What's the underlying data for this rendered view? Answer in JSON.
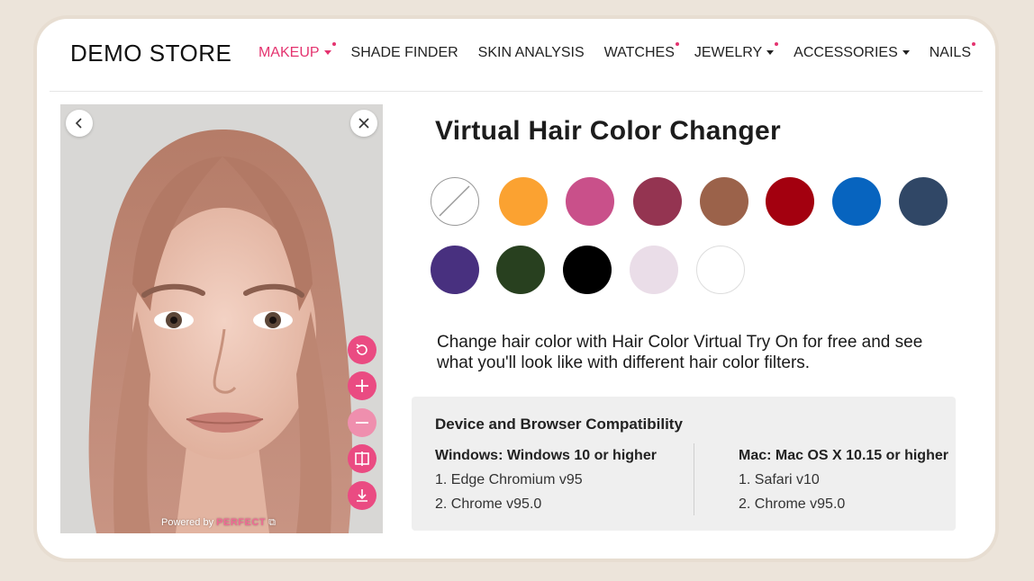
{
  "store": {
    "logo": "DEMO STORE"
  },
  "nav": [
    {
      "label": "MAKEUP",
      "active": true,
      "dropdown": true,
      "dot": true
    },
    {
      "label": "SHADE FINDER",
      "active": false,
      "dropdown": false,
      "dot": false
    },
    {
      "label": "SKIN ANALYSIS",
      "active": false,
      "dropdown": false,
      "dot": false
    },
    {
      "label": "WATCHES",
      "active": false,
      "dropdown": false,
      "dot": true
    },
    {
      "label": "JEWELRY",
      "active": false,
      "dropdown": true,
      "dot": true
    },
    {
      "label": "ACCESSORIES",
      "active": false,
      "dropdown": true,
      "dot": false
    },
    {
      "label": "NAILS",
      "active": false,
      "dropdown": false,
      "dot": true
    }
  ],
  "viewer": {
    "back_icon": "chevron-left-icon",
    "close_icon": "close-icon",
    "tools": [
      "reset-icon",
      "zoom-in-icon",
      "zoom-out-icon",
      "compare-icon",
      "download-icon"
    ],
    "powered_prefix": "Powered by",
    "powered_brand": "PERFECT"
  },
  "main": {
    "title": "Virtual Hair Color Changer",
    "description": "Change hair color with Hair Color Virtual Try On for free and see what you'll look like with different hair color filters.",
    "swatches": [
      {
        "name": "none",
        "color": "#ffffff"
      },
      {
        "name": "orange",
        "color": "#fba231"
      },
      {
        "name": "pink",
        "color": "#c9508a"
      },
      {
        "name": "wine",
        "color": "#943451"
      },
      {
        "name": "brown",
        "color": "#9b624a",
        "selected": true
      },
      {
        "name": "red",
        "color": "#a3000f"
      },
      {
        "name": "blue",
        "color": "#0764bf"
      },
      {
        "name": "navy",
        "color": "#304766"
      },
      {
        "name": "purple",
        "color": "#48307f"
      },
      {
        "name": "dark-green",
        "color": "#28401f"
      },
      {
        "name": "black",
        "color": "#000000"
      },
      {
        "name": "light-pink",
        "color": "#eadde8"
      },
      {
        "name": "white",
        "color": "#ffffff"
      }
    ]
  },
  "compat": {
    "title": "Device and Browser Compatibility",
    "windows": {
      "head": "Windows: Windows 10 or higher",
      "items": [
        "1. Edge Chromium v95",
        "2. Chrome v95.0"
      ]
    },
    "mac": {
      "head": "Mac: Mac OS X 10.15 or higher",
      "items": [
        "1. Safari v10",
        "2. Chrome v95.0"
      ]
    }
  },
  "colors": {
    "accent": "#e4336f",
    "tool": "#ea4b82"
  }
}
